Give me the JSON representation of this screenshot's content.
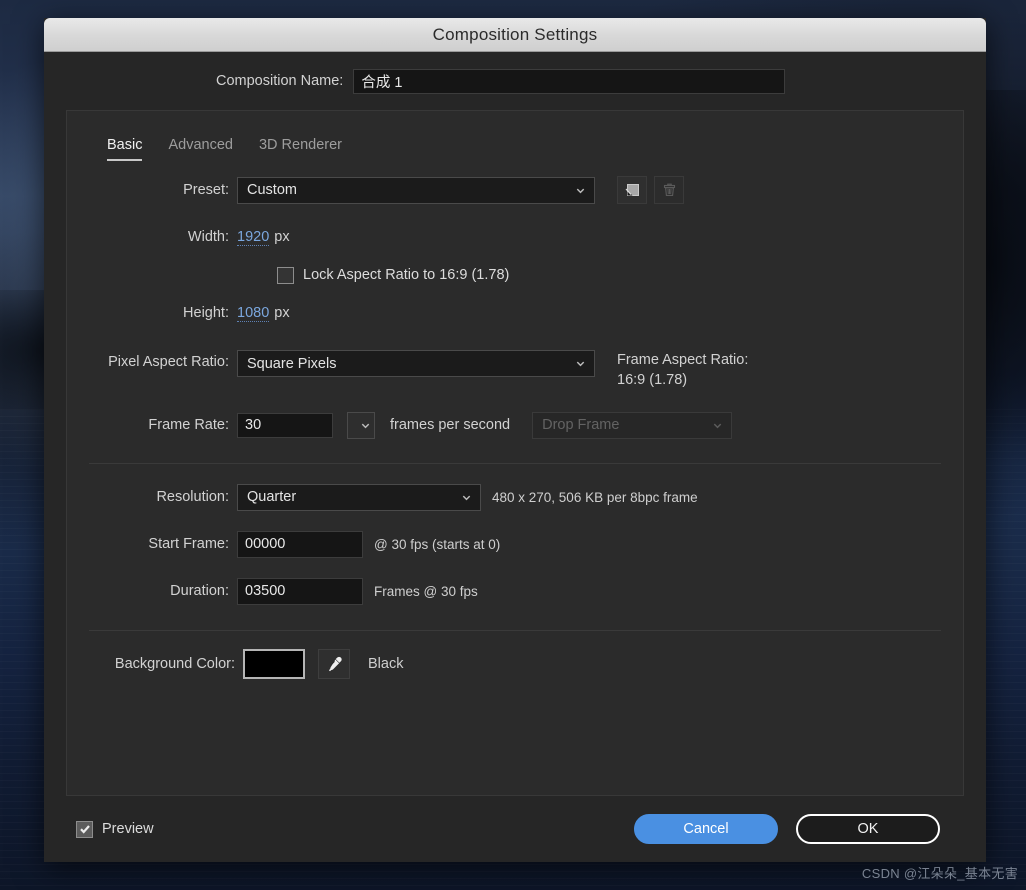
{
  "window": {
    "title": "Composition Settings"
  },
  "composition_name": {
    "label": "Composition Name:",
    "value": "合成 1",
    "placeholder": "Composition Name"
  },
  "tabs": [
    {
      "label": "Basic",
      "active": true
    },
    {
      "label": "Advanced",
      "active": false
    },
    {
      "label": "3D Renderer",
      "active": false
    }
  ],
  "basic": {
    "preset": {
      "label": "Preset:",
      "value": "Custom",
      "save_icon": "new-preset-icon",
      "delete_icon": "trash-icon"
    },
    "width": {
      "label": "Width:",
      "value": "1920",
      "unit": "px"
    },
    "height": {
      "label": "Height:",
      "value": "1080",
      "unit": "px"
    },
    "lock_aspect": {
      "label": "Lock Aspect Ratio to 16:9 (1.78)",
      "checked": false
    },
    "pixel_aspect_ratio": {
      "label": "Pixel Aspect Ratio:",
      "value": "Square Pixels"
    },
    "frame_aspect_ratio": {
      "label": "Frame Aspect Ratio:",
      "value": "16:9 (1.78)"
    },
    "frame_rate": {
      "label": "Frame Rate:",
      "value": "30",
      "unit": "frames per second",
      "drop_frame": "Drop Frame",
      "drop_frame_disabled": true
    },
    "resolution": {
      "label": "Resolution:",
      "value": "Quarter",
      "info": "480 x 270, 506 KB per 8bpc frame"
    },
    "start_frame": {
      "label": "Start Frame:",
      "value": "00000",
      "info": "@ 30 fps (starts at 0)"
    },
    "duration": {
      "label": "Duration:",
      "value": "03500",
      "info": "Frames @ 30 fps"
    },
    "background_color": {
      "label": "Background Color:",
      "swatch_hex": "#000000",
      "name": "Black",
      "eyedropper_icon": "eyedropper-icon"
    }
  },
  "footer": {
    "preview": {
      "label": "Preview",
      "checked": true
    },
    "cancel_label": "Cancel",
    "ok_label": "OK"
  },
  "watermark": "CSDN @江朵朵_基本无害",
  "colors": {
    "accent_blue": "#4a90e2",
    "hot_text_blue": "#7ba7de",
    "dialog_bg": "#262626",
    "panel_bg": "#2b2b2b",
    "titlebar_bg": "#d9d9d9"
  }
}
